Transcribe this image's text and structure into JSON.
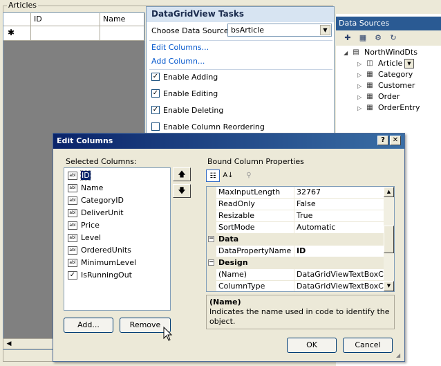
{
  "articles": {
    "label": "Articles",
    "columns": [
      "ID",
      "Name"
    ],
    "new_row_glyph": "✱"
  },
  "tasks": {
    "title": "DataGridView Tasks",
    "data_source_label": "Choose Data Source:",
    "data_source_value": "bsArticle",
    "links": [
      "Edit Columns...",
      "Add Column..."
    ],
    "options": [
      {
        "label": "Enable Adding",
        "checked": true
      },
      {
        "label": "Enable Editing",
        "checked": true
      },
      {
        "label": "Enable Deleting",
        "checked": true
      },
      {
        "label": "Enable Column Reordering",
        "checked": false
      }
    ]
  },
  "data_sources": {
    "title": "Data Sources",
    "toolbar_icons": [
      "add-data-source-icon",
      "edit-dataset-designer-icon",
      "configure-dataset-icon",
      "refresh-icon"
    ],
    "root": "NorthWindDts",
    "items": [
      "Article",
      "Category",
      "Customer",
      "Order",
      "OrderEntry"
    ]
  },
  "dialog": {
    "title": "Edit Columns",
    "help_btn": "?",
    "close_btn": "✕",
    "selected_label": "Selected Columns:",
    "columns": [
      {
        "name": "ID",
        "kind": "textbox"
      },
      {
        "name": "Name",
        "kind": "textbox"
      },
      {
        "name": "CategoryID",
        "kind": "textbox"
      },
      {
        "name": "DeliverUnit",
        "kind": "textbox"
      },
      {
        "name": "Price",
        "kind": "textbox"
      },
      {
        "name": "Level",
        "kind": "textbox"
      },
      {
        "name": "OrderedUnits",
        "kind": "textbox"
      },
      {
        "name": "MinimumLevel",
        "kind": "textbox"
      },
      {
        "name": "IsRunningOut",
        "kind": "checkbox"
      }
    ],
    "selected_index": 0,
    "add_label": "Add...",
    "remove_label": "Remove",
    "bound_label": "Bound Column Properties",
    "properties": [
      {
        "type": "row",
        "name": "MaxInputLength",
        "value": "32767"
      },
      {
        "type": "row",
        "name": "ReadOnly",
        "value": "False"
      },
      {
        "type": "row",
        "name": "Resizable",
        "value": "True"
      },
      {
        "type": "row",
        "name": "SortMode",
        "value": "Automatic"
      },
      {
        "type": "cat",
        "name": "Data"
      },
      {
        "type": "row",
        "name": "DataPropertyName",
        "value": "ID",
        "bold": true
      },
      {
        "type": "cat",
        "name": "Design"
      },
      {
        "type": "row",
        "name": "(Name)",
        "value": "DataGridViewTextBoxColu"
      },
      {
        "type": "row",
        "name": "ColumnType",
        "value": "DataGridViewTextBoxColu"
      }
    ],
    "help_title": "(Name)",
    "help_text": "Indicates the name used in code to identify the object.",
    "ok_label": "OK",
    "cancel_label": "Cancel"
  },
  "colors": {
    "title_bar": "#0a246a",
    "link": "#0055cc",
    "selection": "#0a246a",
    "panel_header": "#2a5a93"
  }
}
